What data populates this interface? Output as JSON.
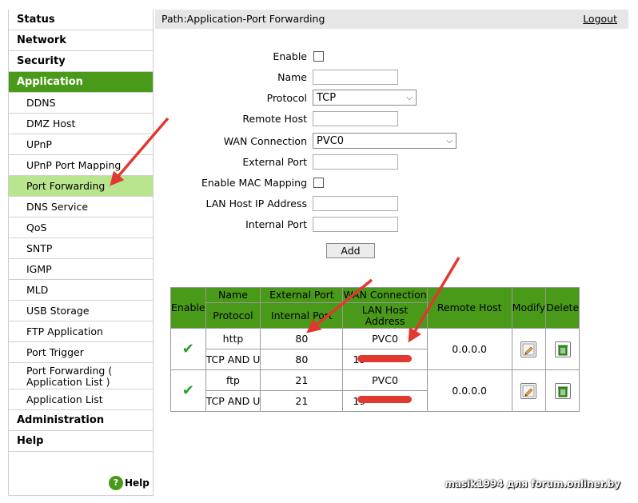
{
  "sidebar": {
    "status": "Status",
    "network": "Network",
    "security": "Security",
    "application": "Application",
    "items": [
      "DDNS",
      "DMZ Host",
      "UPnP",
      "UPnP Port Mapping",
      "Port Forwarding",
      "DNS Service",
      "QoS",
      "SNTP",
      "IGMP",
      "MLD",
      "USB Storage",
      "FTP Application",
      "Port Trigger",
      "Port Forwarding ( Application List )",
      "Application List"
    ],
    "administration": "Administration",
    "help": "Help",
    "help_link": "Help"
  },
  "header": {
    "path": "Path:Application-Port Forwarding",
    "logout": "Logout"
  },
  "form": {
    "enable_label": "Enable",
    "name_label": "Name",
    "protocol_label": "Protocol",
    "protocol_value": "TCP",
    "remote_host_label": "Remote Host",
    "wan_label": "WAN Connection",
    "wan_value": "PVC0",
    "external_port_label": "External Port",
    "mac_label": "Enable MAC Mapping",
    "lan_ip_label": "LAN Host IP Address",
    "internal_port_label": "Internal Port",
    "add_button": "Add"
  },
  "table": {
    "headers": {
      "enable": "Enable",
      "name": "Name",
      "protocol": "Protocol",
      "external_port": "External Port",
      "internal_port": "Internal Port",
      "wan_connection": "WAN Connection",
      "lan_host": "LAN Host Address",
      "remote_host": "Remote Host",
      "modify": "Modify",
      "delete": "Delete"
    },
    "rows": [
      {
        "name": "http",
        "protocol": "TCP AND U",
        "external_port": "80",
        "internal_port": "80",
        "wan": "PVC0",
        "lan_host": "19",
        "remote_host": "0.0.0.0"
      },
      {
        "name": "ftp",
        "protocol": "TCP AND U",
        "external_port": "21",
        "internal_port": "21",
        "wan": "PVC0",
        "lan_host": "19",
        "remote_host": "0.0.0.0"
      }
    ]
  },
  "watermark": "masik1994 для forum.onliner.by",
  "colors": {
    "accent": "#4a9a1a",
    "active_sub": "#b9e58f",
    "arrow": "#e03a30"
  }
}
